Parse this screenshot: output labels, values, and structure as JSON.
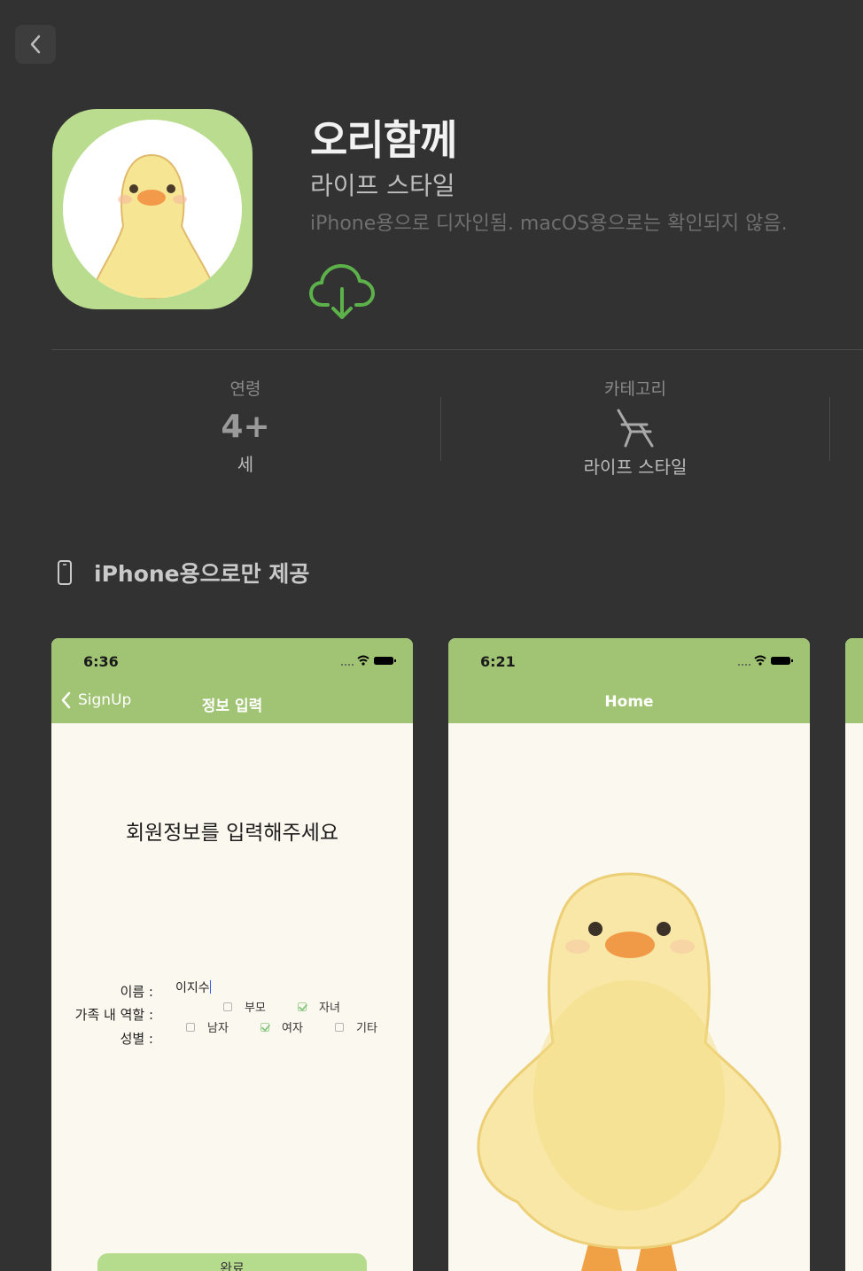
{
  "app": {
    "title": "오리함께",
    "category": "라이프 스타일",
    "compat_note": "iPhone용으로 디자인됨. macOS용으로는 확인되지 않음."
  },
  "info": {
    "age": {
      "label": "연령",
      "value": "4+",
      "unit": "세"
    },
    "category": {
      "label": "카테고리",
      "value": "라이프 스타일"
    }
  },
  "platform": {
    "text": "iPhone용으로만 제공"
  },
  "screenshot1": {
    "time": "6:36",
    "back_label": "SignUp",
    "nav_title": "정보 입력",
    "heading": "회원정보를 입력해주세요",
    "name_label": "이름 :",
    "name_value": "이지수",
    "role_label": "가족 내 역할 :",
    "gender_label": "성별 :",
    "role_options": [
      {
        "label": "부모",
        "checked": false
      },
      {
        "label": "자녀",
        "checked": true
      }
    ],
    "gender_options": [
      {
        "label": "남자",
        "checked": false
      },
      {
        "label": "여자",
        "checked": true
      },
      {
        "label": "기타",
        "checked": false
      }
    ],
    "submit_label": "완료"
  },
  "screenshot2": {
    "time": "6:21",
    "nav_title": "Home"
  },
  "colors": {
    "background": "#323232",
    "accent_green": "#a0c473",
    "icon_green": "#b9dc8e",
    "download_green": "#5db14a",
    "screen_bg": "#fbf8ef"
  }
}
